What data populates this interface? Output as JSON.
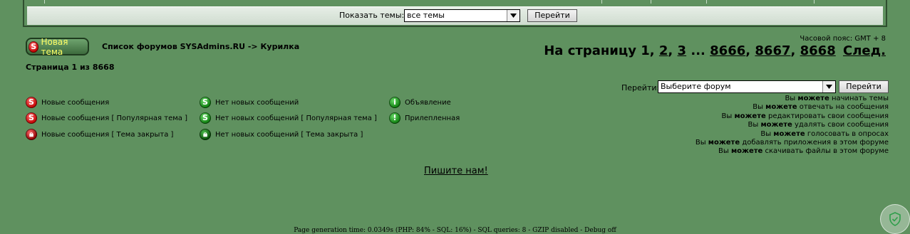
{
  "filter": {
    "label": "Показать темы:",
    "selected": "все темы",
    "go_label": "Перейти"
  },
  "header": {
    "new_topic_label": "Новая тема",
    "new_topic_icon_letter": "S",
    "breadcrumb": "Список форумов SYSAdmins.RU -> Курилка",
    "timezone": "Часовой пояс: GMT + 8"
  },
  "pagination": {
    "prefix": "На страницу 1,",
    "pages": [
      "2",
      "3"
    ],
    "ellipsis": "...",
    "last_pages": [
      "8666",
      "8667",
      "8668"
    ],
    "next": "След."
  },
  "page_count": "Страница 1 из 8668",
  "jump": {
    "label": "Перейти:",
    "selected": "Выберите форум",
    "go_label": "Перейти"
  },
  "legend": {
    "col1": [
      "Новые сообщения",
      "Новые сообщения [ Популярная тема ]",
      "Новые сообщения [ Тема закрыта ]"
    ],
    "col2": [
      "Нет новых сообщений",
      "Нет новых сообщений [ Популярная тема ]",
      "Нет новых сообщений [ Тема закрыта ]"
    ],
    "col3": [
      "Объявление",
      "Прилепленная"
    ]
  },
  "permissions": [
    {
      "pre": "Вы",
      "bold": "можете",
      "post": "начинать темы"
    },
    {
      "pre": "Вы",
      "bold": "можете",
      "post": "отвечать на сообщения"
    },
    {
      "pre": "Вы",
      "bold": "можете",
      "post": "редактировать свои сообщения"
    },
    {
      "pre": "Вы",
      "bold": "можете",
      "post": "удалять свои сообщения"
    },
    {
      "pre": "Вы",
      "bold": "можете",
      "post": "голосовать в опросах"
    },
    {
      "pre": "Вы",
      "bold": "можете",
      "post": "добавлять приложения в этом форуме"
    },
    {
      "pre": "Вы",
      "bold": "можете",
      "post": "скачивать файлы в этом форуме"
    }
  ],
  "contact_link": "Пишите нам!",
  "footer": "Page generation time: 0.0349s (PHP: 84% - SQL: 16%) - SQL queries: 8 - GZIP disabled - Debug off",
  "colors": {
    "background": "#5f915f",
    "link_text": "#000000",
    "new_topic_text": "#ffff66"
  },
  "icons": [
    "chevron-down-icon",
    "new-posts-icon",
    "no-new-posts-icon",
    "locked-icon",
    "announcement-icon",
    "sticky-icon",
    "shield-check-icon"
  ]
}
